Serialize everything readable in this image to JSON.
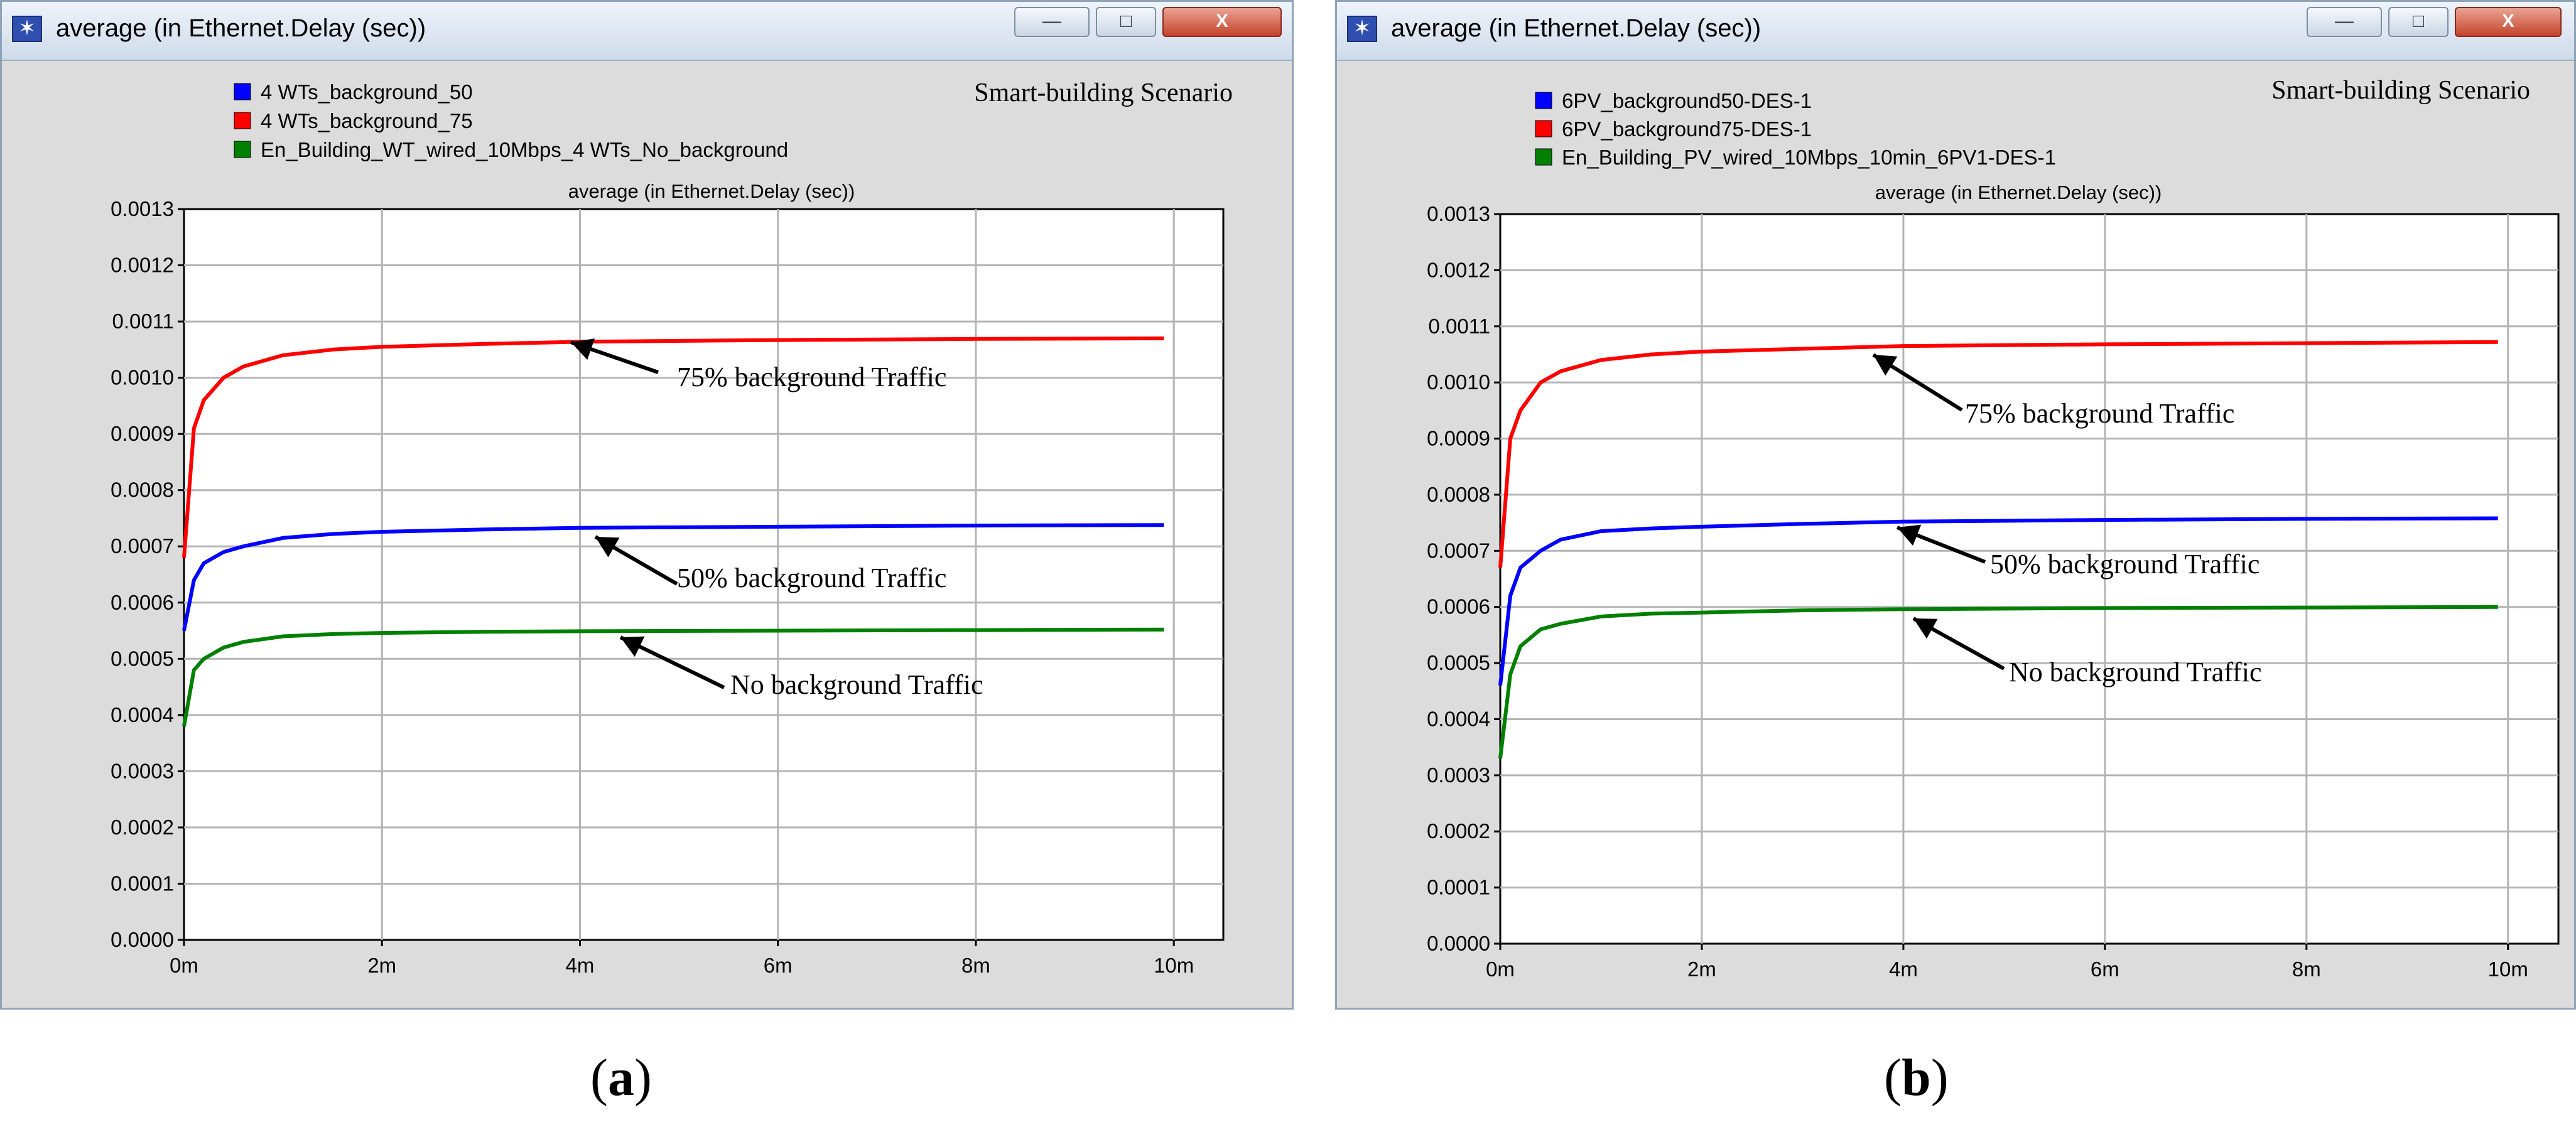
{
  "panels": [
    {
      "window_title": "average (in Ethernet.Delay (sec))",
      "scenario_label": "Smart-building Scenario",
      "annotations": [
        "75% background Traffic",
        "50% background Traffic",
        "No background Traffic"
      ],
      "figure_label": "a"
    },
    {
      "window_title": "average (in Ethernet.Delay (sec))",
      "scenario_label": "Smart-building Scenario",
      "annotations": [
        "75% background Traffic",
        "50% background Traffic",
        "No background Traffic"
      ],
      "figure_label": "b"
    }
  ],
  "window_controls": {
    "minimize": "—",
    "maximize": "□",
    "close": "X"
  },
  "chart_data": [
    {
      "type": "line",
      "title": "average (in Ethernet.Delay (sec))",
      "xlabel": "",
      "ylabel": "",
      "x_unit": "minutes",
      "xlim": [
        0,
        10.5
      ],
      "ylim": [
        0,
        0.0013
      ],
      "x_ticks": [
        0,
        2,
        4,
        6,
        8,
        10
      ],
      "x_tick_labels": [
        "0m",
        "2m",
        "4m",
        "6m",
        "8m",
        "10m"
      ],
      "y_ticks": [
        0,
        0.0001,
        0.0002,
        0.0003,
        0.0004,
        0.0005,
        0.0006,
        0.0007,
        0.0008,
        0.0009,
        0.001,
        0.0011,
        0.0012,
        0.0013
      ],
      "y_tick_labels": [
        "0.0000",
        "0.0001",
        "0.0002",
        "0.0003",
        "0.0004",
        "0.0005",
        "0.0006",
        "0.0007",
        "0.0008",
        "0.0009",
        "0.0010",
        "0.0011",
        "0.0012",
        "0.0013"
      ],
      "grid": true,
      "legend_position": "top-left",
      "colors": [
        "#0000ff",
        "#ff0000",
        "#008000"
      ],
      "series": [
        {
          "name": "4 WTs_background_50",
          "x": [
            0,
            0.1,
            0.2,
            0.4,
            0.6,
            1,
            1.5,
            2,
            3,
            4,
            6,
            8,
            9.9
          ],
          "values": [
            0.00055,
            0.00064,
            0.00067,
            0.00069,
            0.0007,
            0.000715,
            0.000722,
            0.000726,
            0.00073,
            0.000733,
            0.000735,
            0.000737,
            0.000738
          ]
        },
        {
          "name": "4 WTs_background_75",
          "x": [
            0,
            0.1,
            0.2,
            0.4,
            0.6,
            1,
            1.5,
            2,
            3,
            4,
            6,
            8,
            9.9
          ],
          "values": [
            0.00068,
            0.00091,
            0.00096,
            0.001,
            0.00102,
            0.00104,
            0.00105,
            0.001055,
            0.00106,
            0.001064,
            0.001067,
            0.001069,
            0.00107
          ]
        },
        {
          "name": "En_Building_WT_wired_10Mbps_4 WTs_No_background",
          "x": [
            0,
            0.1,
            0.2,
            0.4,
            0.6,
            1,
            1.5,
            2,
            3,
            4,
            6,
            8,
            9.9
          ],
          "values": [
            0.00038,
            0.00048,
            0.0005,
            0.00052,
            0.00053,
            0.00054,
            0.000544,
            0.000546,
            0.000548,
            0.000549,
            0.00055,
            0.000551,
            0.000552
          ]
        }
      ]
    },
    {
      "type": "line",
      "title": "average (in Ethernet.Delay (sec))",
      "xlabel": "",
      "ylabel": "",
      "x_unit": "minutes",
      "xlim": [
        0,
        10.5
      ],
      "ylim": [
        0,
        0.0013
      ],
      "x_ticks": [
        0,
        2,
        4,
        6,
        8,
        10
      ],
      "x_tick_labels": [
        "0m",
        "2m",
        "4m",
        "6m",
        "8m",
        "10m"
      ],
      "y_ticks": [
        0,
        0.0001,
        0.0002,
        0.0003,
        0.0004,
        0.0005,
        0.0006,
        0.0007,
        0.0008,
        0.0009,
        0.001,
        0.0011,
        0.0012,
        0.0013
      ],
      "y_tick_labels": [
        "0.0000",
        "0.0001",
        "0.0002",
        "0.0003",
        "0.0004",
        "0.0005",
        "0.0006",
        "0.0007",
        "0.0008",
        "0.0009",
        "0.0010",
        "0.0011",
        "0.0012",
        "0.0013"
      ],
      "grid": true,
      "legend_position": "top-left",
      "colors": [
        "#0000ff",
        "#ff0000",
        "#008000"
      ],
      "series": [
        {
          "name": "6PV_background50-DES-1",
          "x": [
            0,
            0.1,
            0.2,
            0.4,
            0.6,
            1,
            1.5,
            2,
            3,
            4,
            6,
            8,
            9.9
          ],
          "values": [
            0.00046,
            0.00062,
            0.00067,
            0.0007,
            0.00072,
            0.000735,
            0.00074,
            0.000743,
            0.000748,
            0.000752,
            0.000755,
            0.000757,
            0.000758
          ]
        },
        {
          "name": "6PV_background75-DES-1",
          "x": [
            0,
            0.1,
            0.2,
            0.4,
            0.6,
            1,
            1.5,
            2,
            3,
            4,
            6,
            8,
            9.9
          ],
          "values": [
            0.00067,
            0.0009,
            0.00095,
            0.001,
            0.00102,
            0.00104,
            0.00105,
            0.001055,
            0.00106,
            0.001065,
            0.001068,
            0.00107,
            0.001072
          ]
        },
        {
          "name": "En_Building_PV_wired_10Mbps_10min_6PV1-DES-1",
          "x": [
            0,
            0.1,
            0.2,
            0.4,
            0.6,
            1,
            1.5,
            2,
            3,
            4,
            6,
            8,
            9.9
          ],
          "values": [
            0.00033,
            0.00048,
            0.00053,
            0.00056,
            0.00057,
            0.000583,
            0.000588,
            0.00059,
            0.000594,
            0.000596,
            0.000598,
            0.000599,
            0.0006
          ]
        }
      ]
    }
  ]
}
